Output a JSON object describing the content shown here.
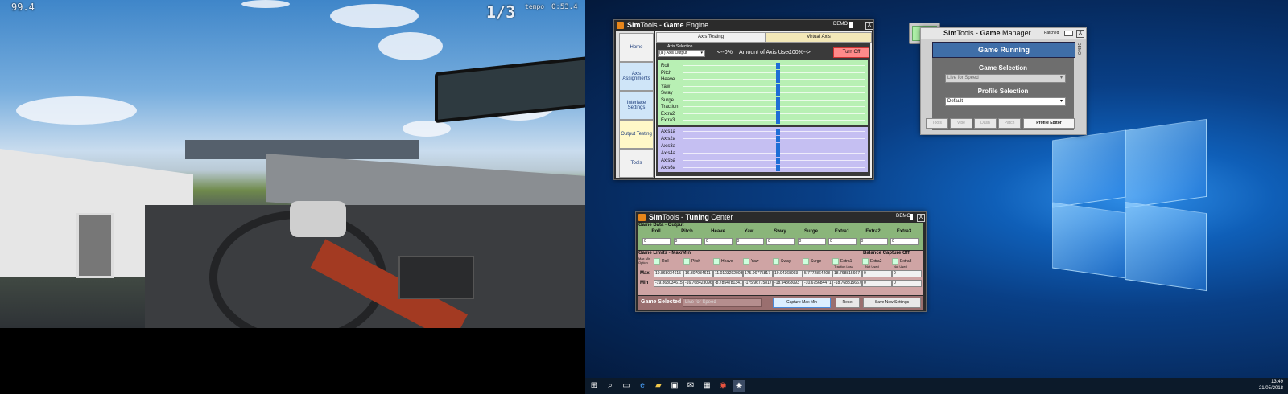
{
  "game": {
    "speed": "99.4",
    "lap": "1/3",
    "time_label": "tempo",
    "time_value": "0:53.4"
  },
  "game_engine": {
    "title_prefix": "Sim",
    "title_tools": "Tools",
    "title_sep": " - ",
    "title_game": "Game",
    "title_suffix": " Engine",
    "demo": "DEMO",
    "close": "X",
    "nav": [
      "Home",
      "Axis Assignments",
      "Interface Settings",
      "Output Testing",
      "Tools"
    ],
    "tabs": [
      "Axis Testing",
      "Virtual Axis"
    ],
    "axis_selection_label": "Axis Selection",
    "axis_selection_value": "(a ) Axis Output",
    "range_left": "<--0%",
    "range_mid": "Amount of Axis Used",
    "range_right": "100%-->",
    "turn_off": "Turn Off",
    "dof_axes": [
      "Roll",
      "Pitch",
      "Heave",
      "Yaw",
      "Sway",
      "Surge",
      "Traction",
      "Extra2",
      "Extra3"
    ],
    "out_axes": [
      "Axis1a",
      "Axis2a",
      "Axis3a",
      "Axis4a",
      "Axis5a",
      "Axis6a"
    ]
  },
  "game_manager": {
    "toggle": "On",
    "title_prefix": "Sim",
    "title_tools": "Tools",
    "title_sep": " - ",
    "title_game": "Game",
    "title_suffix": " Manager",
    "patched": "Patched",
    "close": "X",
    "demo": "DEMO",
    "status": "Game Running",
    "game_selection_label": "Game Selection",
    "game_selection_value": "Live for Speed",
    "profile_selection_label": "Profile Selection",
    "profile_selection_value": "Default",
    "buttons": [
      "Tools",
      "Vibe",
      "Dash",
      "Patch",
      "Profile Editor"
    ]
  },
  "tuning": {
    "title_prefix": "Sim",
    "title_tools": "Tools",
    "title_sep": " - ",
    "title_a": "Tuning",
    "title_b": " Center",
    "demo": "DEMO",
    "close": "X",
    "game_data_label": "Game Data - Output",
    "columns": [
      "Roll",
      "Pitch",
      "Heave",
      "Yaw",
      "Sway",
      "Surge",
      "Extra1",
      "Extra2",
      "Extra3"
    ],
    "output_values": [
      "0",
      "0",
      "0",
      "0",
      "0",
      "0",
      "0",
      "0",
      "0"
    ],
    "limits_label": "Game Limits - Max/Min",
    "balance_label": "Balance Capture",
    "balance_state": "Off",
    "maxmin_option": "Max Min Option",
    "traction_loss": "Traction Loss",
    "not_used_1": "Not Used",
    "not_used_2": "Not Used",
    "max_label": "Max",
    "min_label": "Min",
    "max_values": [
      "19.868034615",
      "16.307934611",
      "11.0103292003",
      "175.96775817",
      "19.94368093",
      "5.7772864208",
      "18.768815667",
      "0",
      "0"
    ],
    "min_values": [
      "-19.868034615",
      "-16.768423096",
      "-8.7854781341",
      "-175.96775817",
      "-18.94368093",
      "-10.675684471",
      "-18.768815667",
      "0",
      "0"
    ],
    "game_selected_label": "Game Selected",
    "game_selected_value": "Live for Speed",
    "capture_btn": "Capture Max Min",
    "reset_btn": "Reset",
    "save_btn": "Save New Settings"
  },
  "taskbar": {
    "time": "13:49",
    "date": "21/05/2018"
  }
}
